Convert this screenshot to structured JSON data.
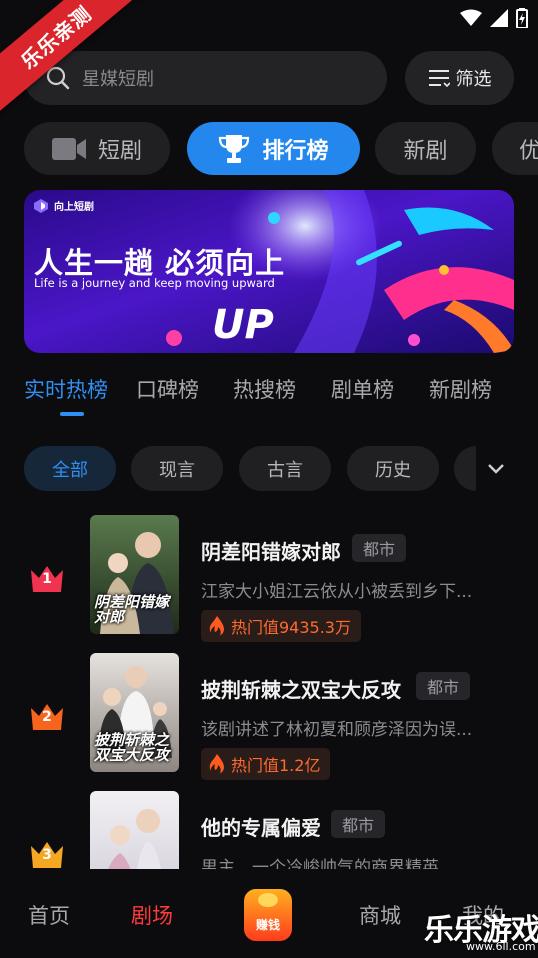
{
  "watermark": {
    "corner_label": "乐乐亲测",
    "site_name": "乐乐游戏",
    "site_url": "www.6ll.com"
  },
  "search": {
    "placeholder": "星媒短剧",
    "icon": "search-icon"
  },
  "filter": {
    "label": "筛选",
    "icon": "filter-icon"
  },
  "categories": [
    {
      "label": "短剧",
      "icon": "video-camera-icon",
      "active": false
    },
    {
      "label": "排行榜",
      "icon": "trophy-icon",
      "active": true
    },
    {
      "label": "新剧",
      "active": false
    },
    {
      "label": "优",
      "active": false
    }
  ],
  "banner": {
    "brand": "向上短剧",
    "title": "人生一趟  必须向上",
    "subtitle": "Life is a journey and  keep moving upward",
    "graphic_text": "UP"
  },
  "tabs": [
    {
      "label": "实时热榜",
      "active": true
    },
    {
      "label": "口碑榜"
    },
    {
      "label": "热搜榜"
    },
    {
      "label": "剧单榜"
    },
    {
      "label": "新剧榜"
    }
  ],
  "genres": [
    {
      "label": "全部",
      "active": true
    },
    {
      "label": "现言"
    },
    {
      "label": "古言"
    },
    {
      "label": "历史"
    }
  ],
  "colors": {
    "accent": "#2f8ff3",
    "nav_active": "#ff3b3b",
    "rank1": "#f0344f",
    "rank2": "#f5651d",
    "rank3": "#f5a623",
    "heat": "#ff6a2f"
  },
  "dramas": [
    {
      "rank": "1",
      "title": "阴差阳错嫁对郎",
      "tag": "都市",
      "desc": "江家大小姐江云依从小被丢到乡下...",
      "heat": "热门值9435.3万",
      "poster_text": "阴差阳错嫁对郎"
    },
    {
      "rank": "2",
      "title": "披荆斩棘之双宝大反攻",
      "tag": "都市",
      "desc": "该剧讲述了林初夏和顾彦泽因为误...",
      "heat": "热门值1.2亿",
      "poster_text": "披荆斩棘之双宝大反攻"
    },
    {
      "rank": "3",
      "title": "他的专属偏爱",
      "tag": "都市",
      "desc": "男主，一个冷峻帅气的商界精英，...",
      "heat": "",
      "poster_text": ""
    }
  ],
  "nav": [
    {
      "label": "首页",
      "active": false
    },
    {
      "label": "剧场",
      "active": true
    },
    {
      "label": "赚钱",
      "type": "special"
    },
    {
      "label": "商城",
      "active": false
    },
    {
      "label": "我的",
      "active": false
    }
  ]
}
